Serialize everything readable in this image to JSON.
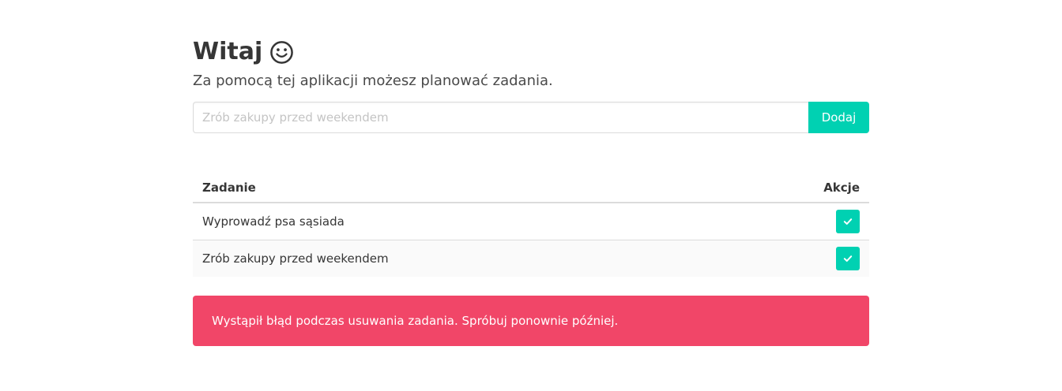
{
  "header": {
    "title": "Witaj",
    "icon": "smile-icon",
    "subtitle": "Za pomocą tej aplikacji możesz planować zadania."
  },
  "form": {
    "input_value": "",
    "input_placeholder": "Zrób zakupy przed weekendem",
    "add_label": "Dodaj"
  },
  "table": {
    "headers": {
      "task": "Zadanie",
      "actions": "Akcje"
    },
    "rows": [
      {
        "task": "Wyprowadź psa sąsiada",
        "action_icon": "check-icon"
      },
      {
        "task": "Zrób zakupy przed weekendem",
        "action_icon": "check-icon"
      }
    ]
  },
  "notification": {
    "type": "danger",
    "text": "Wystąpił błąd podczas usuwania zadania. Spróbuj ponownie później."
  },
  "colors": {
    "primary": "#00d1b2",
    "danger": "#f14668",
    "text": "#363636"
  }
}
